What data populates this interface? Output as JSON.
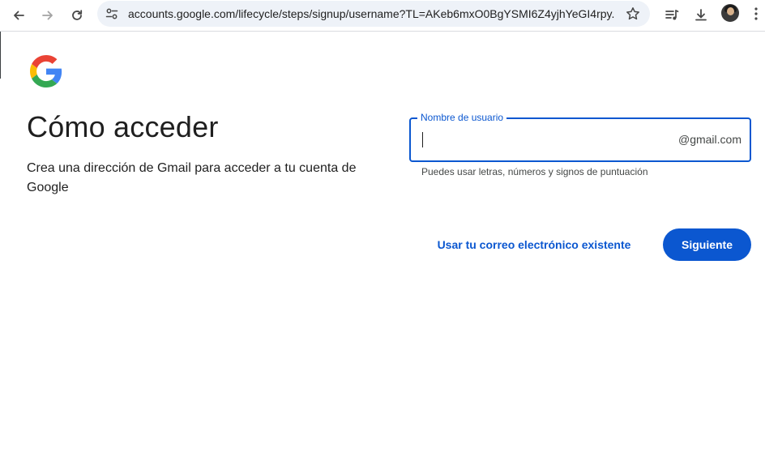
{
  "browser": {
    "url": "accounts.google.com/lifecycle/steps/signup/username?TL=AKeb6mxO0BgYSMI6Z4yjhYeGI4rpy...",
    "icons": [
      "back-icon",
      "forward-icon",
      "reload-icon",
      "site-info-icon",
      "bookmark-star-icon",
      "media-control-icon",
      "download-icon",
      "profile-avatar",
      "menu-kebab-icon"
    ]
  },
  "page": {
    "title": "Cómo acceder",
    "subtitle": "Crea una dirección de Gmail para acceder a tu cuenta de Google"
  },
  "username_field": {
    "label": "Nombre de usuario",
    "value": "",
    "suffix": "@gmail.com",
    "helper": "Puedes usar letras, números y signos de puntuación"
  },
  "actions": {
    "use_existing_email": "Usar tu correo electrónico existente",
    "next": "Siguiente"
  },
  "colors": {
    "accent": "#0b57d0",
    "text": "#1f1f1f",
    "omnibox_bg": "#eef2f8",
    "google_blue": "#4285F4",
    "google_red": "#EA4335",
    "google_yellow": "#FBBC05",
    "google_green": "#34A853"
  }
}
